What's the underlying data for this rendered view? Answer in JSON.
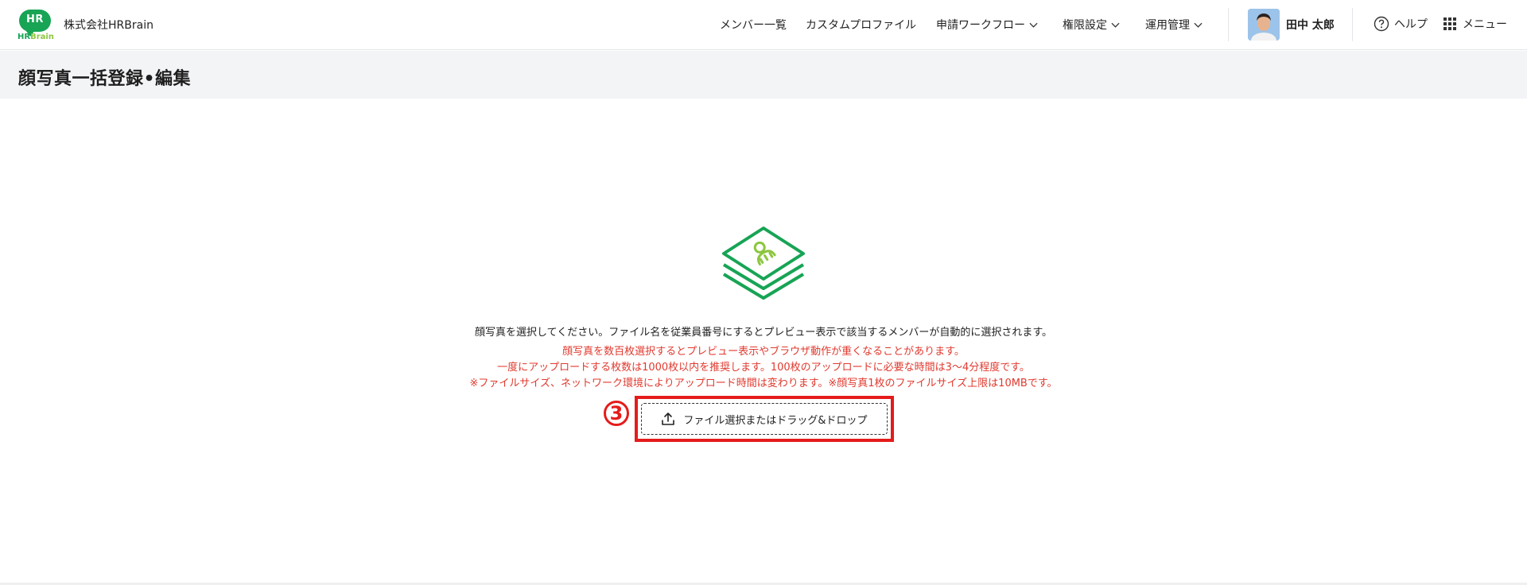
{
  "header": {
    "logo_mark": "HR",
    "logo_text_hr": "HR",
    "logo_text_brain": "Brain",
    "company": "株式会社HRBrain",
    "nav": [
      {
        "label": "メンバー一覧",
        "has_dropdown": false
      },
      {
        "label": "カスタムプロファイル",
        "has_dropdown": false
      },
      {
        "label": "申請ワークフロー",
        "has_dropdown": true
      },
      {
        "label": "権限設定",
        "has_dropdown": true
      },
      {
        "label": "運用管理",
        "has_dropdown": true
      }
    ],
    "user_name": "田中 太郎",
    "help_label": "ヘルプ",
    "menu_label": "メニュー"
  },
  "page": {
    "title": "顔写真一括登録•編集"
  },
  "upload": {
    "description": "顔写真を選択してください。ファイル名を従業員番号にするとプレビュー表示で該当するメンバーが自動的に選択されます。",
    "warnings": [
      "顔写真を数百枚選択するとプレビュー表示やブラウザ動作が重くなることがあります。",
      "一度にアップロードする枚数は1000枚以内を推奨します。100枚のアップロードに必要な時間は3〜4分程度です。",
      "※ファイルサイズ、ネットワーク環境によりアップロード時間は変わります。※顔写真1枚のファイルサイズ上限は10MBです。"
    ],
    "button_label": "ファイル選択またはドラッグ&ドロップ"
  },
  "annotation": {
    "step_number": "3"
  },
  "colors": {
    "brand_green": "#17a455",
    "brand_light_green": "#8cc63f",
    "warning_red": "#e03a2f",
    "highlight_red": "#e51b1b",
    "title_band_bg": "#f3f4f6"
  },
  "icons": [
    "upload-icon",
    "help-circle-icon",
    "grid-menu-icon",
    "chevron-down-icon",
    "photo-stack-illustration"
  ]
}
